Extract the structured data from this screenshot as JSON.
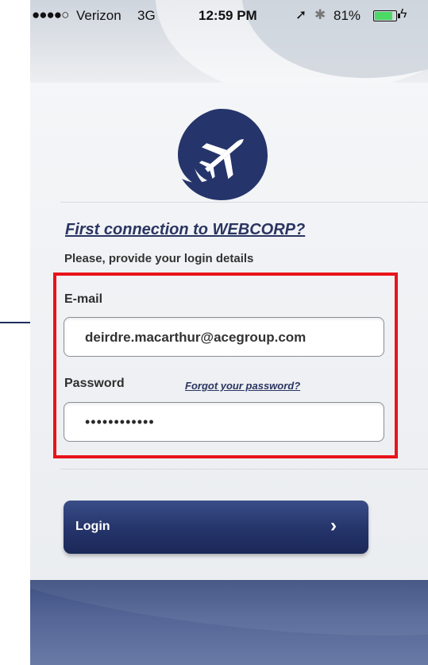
{
  "status_bar": {
    "signal": "●●●●○",
    "carrier": "Verizon",
    "network": "3G",
    "time": "12:59 PM",
    "battery": "81%",
    "location_icon": "location-arrow-icon",
    "bluetooth_icon": "bluetooth-icon",
    "charging_icon": "charging-bolt-icon"
  },
  "logo": {
    "icon": "airplane-logo-icon"
  },
  "login_form": {
    "heading": "First connection to WEBCORP?",
    "instruction": "Please, provide your login details",
    "email": {
      "label": "E-mail",
      "value": "deirdre.macarthur@acegroup.com"
    },
    "password": {
      "label": "Password",
      "value": "••••••••••••",
      "forgot_link": "Forgot your password?"
    },
    "login_button": {
      "label": "Login",
      "icon": "chevron-right-icon",
      "glyph": "›"
    }
  },
  "colors": {
    "brand": "#25356b",
    "highlight": "#e8141b",
    "battery_fill": "#4cd964"
  }
}
